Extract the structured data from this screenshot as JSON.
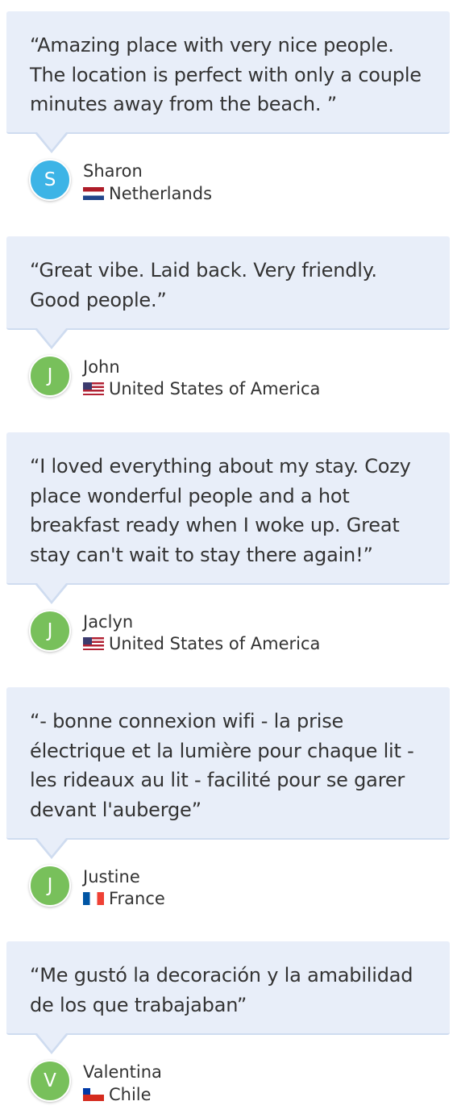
{
  "colors": {
    "bubble_bg": "#e8eef9",
    "avatar_blue": "#3db4e6",
    "avatar_green": "#78c05b"
  },
  "reviews": [
    {
      "quote_lines": [
        "“Amazing place with very nice people.",
        "The location is perfect with only a couple",
        "minutes away from the beach. ”"
      ],
      "initial": "S",
      "avatar_color": "#3db4e6",
      "name": "Sharon",
      "country": "Netherlands",
      "flag_icon": "netherlands-flag-icon"
    },
    {
      "quote_lines": [
        "“Great vibe. Laid back. Very friendly.",
        "Good people.”"
      ],
      "initial": "J",
      "avatar_color": "#78c05b",
      "name": "John",
      "country": "United States of America",
      "flag_icon": "usa-flag-icon"
    },
    {
      "quote_lines": [
        "“I loved everything about my stay. Cozy",
        "place wonderful people and a hot",
        "breakfast ready when I woke up. Great",
        "stay can't wait to stay there again!”"
      ],
      "initial": "J",
      "avatar_color": "#78c05b",
      "name": "Jaclyn",
      "country": "United States of America",
      "flag_icon": "usa-flag-icon"
    },
    {
      "quote_lines": [
        "“- bonne connexion wifi - la prise",
        "électrique et la lumière pour chaque lit -",
        "les rideaux au lit - facilité pour se garer",
        "devant l'auberge”"
      ],
      "initial": "J",
      "avatar_color": "#78c05b",
      "name": "Justine",
      "country": "France",
      "flag_icon": "france-flag-icon"
    },
    {
      "quote_lines": [
        "“Me gustó la decoración y la amabilidad",
        "de los que trabajaban”"
      ],
      "initial": "V",
      "avatar_color": "#78c05b",
      "name": "Valentina",
      "country": "Chile",
      "flag_icon": "chile-flag-icon"
    }
  ]
}
